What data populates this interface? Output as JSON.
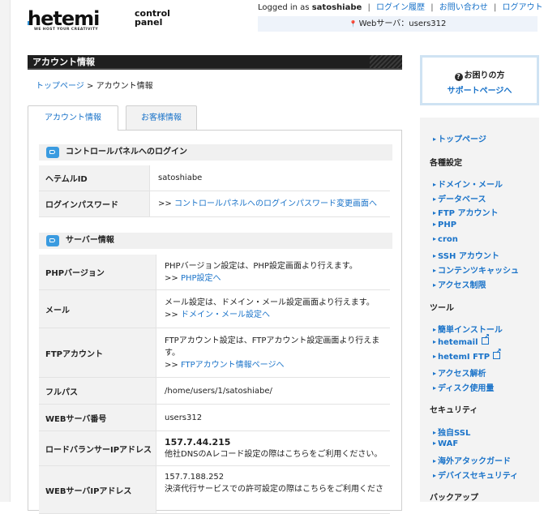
{
  "header": {
    "logo_word": "hetemi",
    "logo_sub": "control panel",
    "logo_tagline": "WE HOST YOUR CREATIVITY",
    "logged_in_prefix": "Logged in as",
    "username": "satoshiabe",
    "links": [
      "ログイン履歴",
      "お問い合わせ",
      "ログアウト"
    ],
    "server_label": "Webサーバ：users312"
  },
  "page": {
    "title": "アカウント情報",
    "breadcrumb_top": "トップページ",
    "breadcrumb_sep": ">",
    "breadcrumb_current": "アカウント情報"
  },
  "tabs": [
    "アカウント情報",
    "お客様情報"
  ],
  "login_section": {
    "title": "コントロールパネルへのログイン",
    "rows": [
      {
        "key": "ヘテムルID",
        "value": "satoshiabe"
      },
      {
        "key": "ログインパスワード",
        "prefix": ">>",
        "link": "コントロールパネルへのログインパスワード変更画面へ"
      }
    ]
  },
  "server_section": {
    "title": "サーバー情報",
    "php": {
      "key": "PHPバージョン",
      "text": "PHPバージョン設定は、PHP設定画面より行えます。",
      "prefix": ">>",
      "link": "PHP設定へ"
    },
    "mail": {
      "key": "メール",
      "text": "メール設定は、ドメイン・メール設定画面より行えます。",
      "prefix": ">>",
      "link": "ドメイン・メール設定へ"
    },
    "ftp": {
      "key": "FTPアカウント",
      "text1": "FTPアカウント設定は、FTPアカウント設定画面より行えま",
      "text2": "す。",
      "prefix": ">>",
      "link": "FTPアカウント情報ページへ"
    },
    "fullpath": {
      "key": "フルパス",
      "value": "/home/users/1/satoshiabe/"
    },
    "webserver": {
      "key": "WEBサーバ番号",
      "value": "users312"
    },
    "lb": {
      "key": "ロードバランサーIPアドレス",
      "value": "157.7.44.215",
      "note": "他社DNSのAレコード設定の際はこちらをご利用ください。"
    },
    "webip": {
      "key": "WEBサーバIPアドレス",
      "value": "157.7.188.252",
      "note": "決済代行サービスでの許可設定の際はこちらをご利用くださ"
    }
  },
  "help": {
    "title": "お困りの方",
    "link": "サポートページへ"
  },
  "sidebar": {
    "top": "トップページ",
    "groups": [
      {
        "head": "各種設定",
        "items": [
          "ドメイン・メール",
          "データベース",
          "FTP アカウント",
          "PHP",
          "cron",
          "SSH アカウント",
          "コンテンツキャッシュ",
          "アクセス制限"
        ]
      },
      {
        "head": "ツール",
        "items": [
          "簡単インストール",
          "hetemail",
          "hetemI FTP",
          "アクセス解析",
          "ディスク使用量"
        ]
      },
      {
        "head": "セキュリティ",
        "items": [
          "独自SSL",
          "WAF",
          "海外アタックガード",
          "デバイスセキュリティ"
        ]
      },
      {
        "head": "バックアップ",
        "items": []
      }
    ]
  }
}
